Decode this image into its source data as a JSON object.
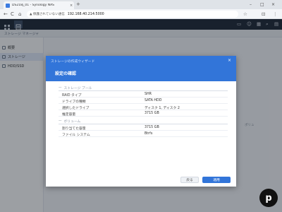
{
  "browser": {
    "tab_title": "DS218j_01 - Synology NAS",
    "tab_close": "×",
    "new_tab": "+",
    "win_minimize": "–",
    "win_maximize": "□",
    "win_close": "×",
    "nav_back": "←",
    "nav_reload": "C",
    "nav_home": "⌂",
    "url_warning": "▲ 保護されていない通信",
    "url": "192.168.40.214:5000",
    "star_icon": "☆",
    "ext_icon": "⊡",
    "menu_icon": "⋮"
  },
  "dsm": {
    "right_icons": [
      "▭",
      "☺",
      "▦",
      "⌕",
      "▤"
    ]
  },
  "app": {
    "title": "ストレージ マネージャ",
    "sidebar": [
      {
        "label": "概要"
      },
      {
        "label": "ストレージ"
      },
      {
        "label": "HDD/SSD"
      }
    ],
    "background_hint": "ポリュ"
  },
  "dialog": {
    "wizard_title": "ストレージの作成ウィザード",
    "title": "設定の確認",
    "close": "×",
    "sections": [
      {
        "toggle": "—",
        "label": "ストレージ プール",
        "rows": [
          {
            "label": "RAID タイプ",
            "value": "SHR"
          },
          {
            "label": "ドライブの種類",
            "value": "SATA HDD"
          },
          {
            "label": "選択したドライブ",
            "value": "ディスク 1, ディスク 2"
          },
          {
            "label": "推定容量",
            "value": "3715 GB"
          }
        ]
      },
      {
        "toggle": "—",
        "label": "ボリューム",
        "rows": [
          {
            "label": "割り当てた容量",
            "value": "3715 GB"
          },
          {
            "label": "ファイル システム",
            "value": "Btrfs"
          }
        ]
      }
    ],
    "back_button": "戻る",
    "apply_button": "適用"
  },
  "corner_logo": "p",
  "colors": {
    "dialog_header": "#3275d9",
    "dsm_bar": "#1d2735",
    "apply_button": "#3275d9"
  }
}
